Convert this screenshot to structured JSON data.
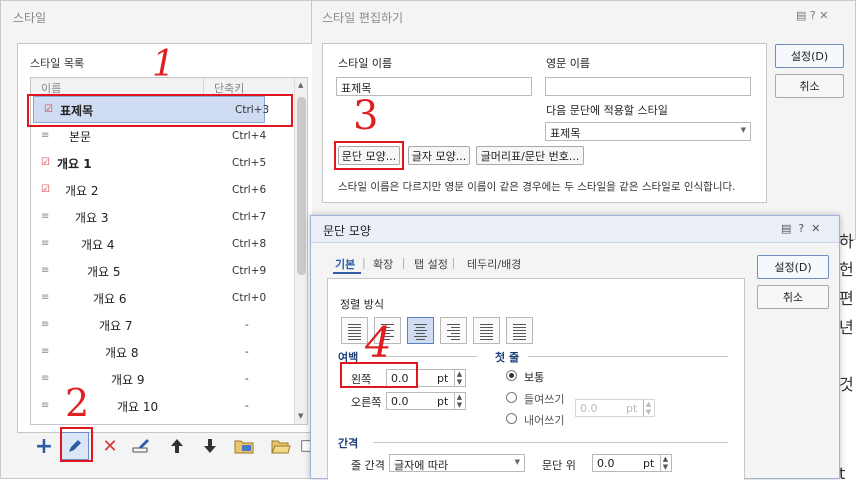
{
  "style_dialog": {
    "title": "스타일",
    "list_label": "스타일 목록",
    "col_name": "이름",
    "col_shortcut": "단축키",
    "items": [
      {
        "name": "표제목",
        "shortcut": "Ctrl+3",
        "icon": "paragraph-style-icon"
      },
      {
        "name": "본문",
        "shortcut": "Ctrl+4",
        "icon": "paragraph-style-icon"
      },
      {
        "name": "개요 1",
        "shortcut": "Ctrl+5",
        "icon": "paragraph-style-icon"
      },
      {
        "name": "개요 2",
        "shortcut": "Ctrl+6",
        "icon": "paragraph-style-icon"
      },
      {
        "name": "개요 3",
        "shortcut": "Ctrl+7",
        "icon": "paragraph-style-icon"
      },
      {
        "name": "개요 4",
        "shortcut": "Ctrl+8",
        "icon": "paragraph-style-icon"
      },
      {
        "name": "개요 5",
        "shortcut": "Ctrl+9",
        "icon": "paragraph-style-icon"
      },
      {
        "name": "개요 6",
        "shortcut": "Ctrl+0",
        "icon": "paragraph-style-icon"
      },
      {
        "name": "개요 7",
        "shortcut": "-",
        "icon": "paragraph-style-icon"
      },
      {
        "name": "개요 8",
        "shortcut": "-",
        "icon": "paragraph-style-icon"
      },
      {
        "name": "개요 9",
        "shortcut": "-",
        "icon": "paragraph-style-icon"
      },
      {
        "name": "개요 10",
        "shortcut": "-",
        "icon": "paragraph-style-icon"
      }
    ]
  },
  "edit_dialog": {
    "title": "스타일 편집하기",
    "style_name_label": "스타일 이름",
    "style_name_value": "표제목",
    "english_name_label": "영문 이름",
    "english_name_value": "",
    "next_style_label": "다음 문단에 적용할 스타일",
    "next_style_value": "표제목",
    "btn_paragraph": "문단 모양...",
    "btn_char": "글자 모양...",
    "btn_bullet": "글머리표/문단 번호...",
    "note": "스타일 이름은 다르지만 영문 이름이 같은 경우에는 두 스타일을 같은 스타일로 인식합니다.",
    "btn_ok": "설정(D)",
    "btn_cancel": "취소"
  },
  "para_dialog": {
    "title": "문단 모양",
    "tabs": [
      "기본",
      "확장",
      "탭 설정",
      "테두리/배경"
    ],
    "align_label": "정렬 방식",
    "margin_label": "여백",
    "left_label": "왼쪽",
    "left_value": "0.0",
    "right_label": "오른쪽",
    "right_value": "0.0",
    "unit": "pt",
    "first_line_label": "첫 줄",
    "radio_normal": "보통",
    "radio_indent": "들여쓰기",
    "radio_outdent": "내어쓰기",
    "indent_value": "0.0",
    "spacing_label": "간격",
    "line_spacing_label": "줄 간격",
    "line_spacing_value": "글자에 따라",
    "para_above_label": "문단 위",
    "para_above_value": "0.0",
    "btn_ok": "설정(D)",
    "btn_cancel": "취소"
  },
  "annotations": {
    "step1": "1",
    "step2": "2",
    "step3": "3",
    "step4": "4"
  },
  "background_text": [
    "하",
    "헌",
    "편",
    "년",
    "것",
    "t"
  ],
  "colors": {
    "accent": "#2e5ba8",
    "annotation": "#e0161e",
    "selected_row": "#cfdcf2"
  }
}
